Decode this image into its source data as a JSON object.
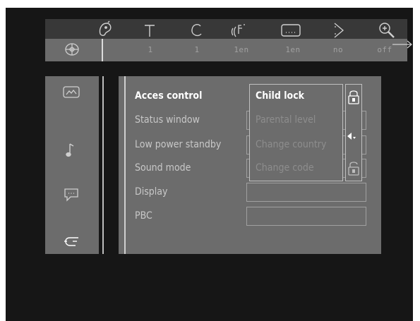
{
  "topbar": {
    "icons": [
      {
        "name": "subtitle-icon"
      },
      {
        "name": "title-icon"
      },
      {
        "name": "chapter-icon"
      },
      {
        "name": "audio-icon"
      },
      {
        "name": "subtitle-box-icon"
      },
      {
        "name": "angle-icon"
      },
      {
        "name": "zoom-icon"
      }
    ]
  },
  "statusbar": {
    "disc_icon": "disc-icon",
    "values": [
      "1",
      "1",
      "1en",
      "1en",
      "no",
      "off"
    ]
  },
  "sidebar": {
    "icons": [
      "picture-settings-icon",
      "sound-settings-icon",
      "language-settings-icon",
      "features-settings-icon"
    ]
  },
  "menu": {
    "items": [
      "Acces control",
      "Status window",
      "Low power standby",
      "Sound mode",
      "Display",
      "PBC"
    ],
    "active_index": 0
  },
  "submenu": {
    "items": [
      "Child lock",
      "Parental level",
      "Change country",
      "Change code"
    ],
    "active_index": 0
  },
  "lock_icons": [
    "lock-closed-icon",
    "lock-open-icon"
  ],
  "colors": {
    "background": "#161616",
    "topbar": "#383838",
    "panel": "#6c6c6c",
    "active_text": "#ffffff",
    "inactive_text": "#c8c8c8",
    "disabled_text": "#8d8d8d"
  }
}
